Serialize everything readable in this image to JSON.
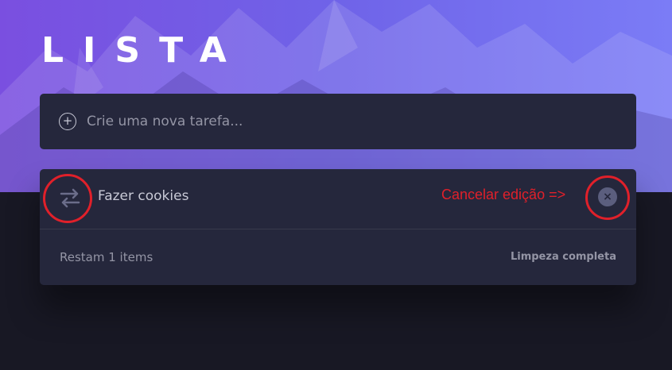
{
  "header": {
    "title": "LISTA"
  },
  "new_task": {
    "icon": "plus-circle-icon",
    "placeholder": "Crie uma nova tarefa..."
  },
  "editing_item": {
    "value": "Fazer cookies",
    "icon": "swap-arrows-icon"
  },
  "annotation": {
    "text": "Cancelar edição =>",
    "color": "#e0202a"
  },
  "cancel": {
    "glyph": "×",
    "icon": "close-icon"
  },
  "footer": {
    "items_left": "Restam 1 items",
    "clear_label": "Limpeza completa"
  },
  "colors": {
    "card": "#25273c",
    "background": "#181824",
    "accent": "#7a4fe0"
  }
}
